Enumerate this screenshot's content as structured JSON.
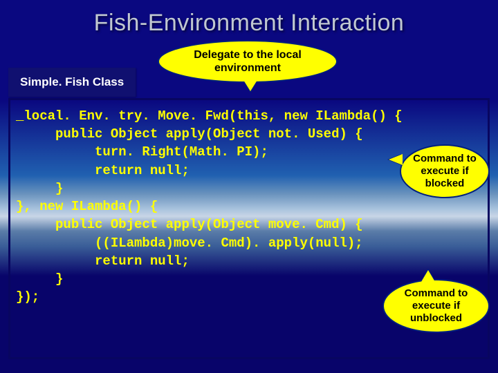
{
  "title": "Fish-Environment Interaction",
  "class_label": "Simple. Fish Class",
  "callouts": {
    "top": "Delegate to the local\nenvironment",
    "mid": "Command to execute if blocked",
    "bot": "Command to execute if unblocked"
  },
  "code_lines": [
    "_local. Env. try. Move. Fwd(this, new ILambda() {",
    "     public Object apply(Object not. Used) {",
    "          turn. Right(Math. PI);",
    "          return null;",
    "     }",
    "}, new ILambda() {",
    "     public Object apply(Object move. Cmd) {",
    "          ((ILambda)move. Cmd). apply(null);",
    "          return null;",
    "     }",
    "});"
  ]
}
